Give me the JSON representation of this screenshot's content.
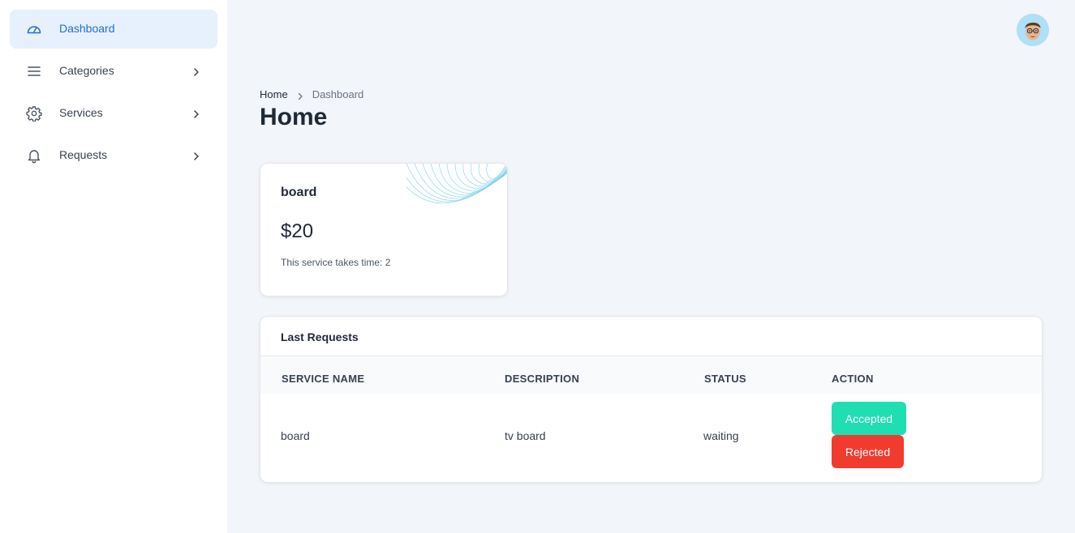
{
  "sidebar": {
    "items": [
      {
        "label": "Dashboard",
        "icon": "speedometer-icon",
        "active": true
      },
      {
        "label": "Categories",
        "icon": "menu-lines-icon",
        "active": false
      },
      {
        "label": "Services",
        "icon": "gear-icon",
        "active": false
      },
      {
        "label": "Requests",
        "icon": "bell-icon",
        "active": false
      }
    ]
  },
  "header": {
    "avatar_icon": "user-avatar-icon"
  },
  "breadcrumb": {
    "home": "Home",
    "current": "Dashboard"
  },
  "page": {
    "title": "Home"
  },
  "stat_card": {
    "name": "board",
    "price": "$20",
    "caption": "This service takes time: 2"
  },
  "requests": {
    "title": "Last Requests",
    "columns": [
      "SERVICE NAME",
      "DESCRIPTION",
      "STATUS",
      "ACTION"
    ],
    "rows": [
      {
        "service_name": "board",
        "description": "tv board",
        "status": "waiting",
        "accept_label": "Accepted",
        "reject_label": "Rejected"
      }
    ]
  },
  "colors": {
    "accent": "#1e6fd9",
    "active_bg": "#e7f0fd",
    "accept": "#1fdeb1",
    "reject": "#f13b2f",
    "page_bg": "#f2f5f9"
  }
}
